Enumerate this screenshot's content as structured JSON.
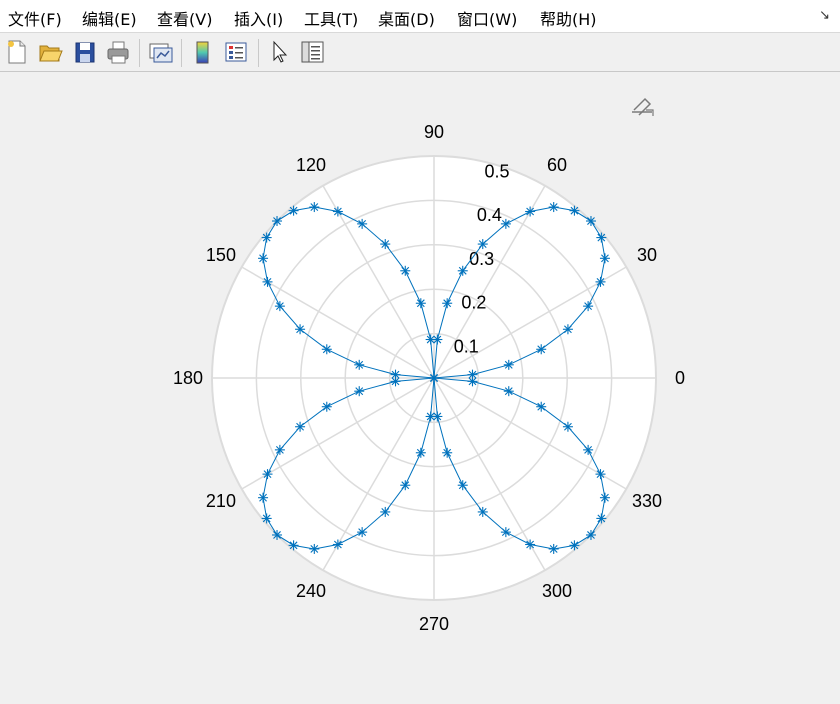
{
  "menubar": {
    "items": [
      {
        "label": "文件(F)",
        "name": "menu-file"
      },
      {
        "label": "编辑(E)",
        "name": "menu-edit"
      },
      {
        "label": "查看(V)",
        "name": "menu-view"
      },
      {
        "label": "插入(I)",
        "name": "menu-insert"
      },
      {
        "label": "工具(T)",
        "name": "menu-tools"
      },
      {
        "label": "桌面(D)",
        "name": "menu-desktop"
      },
      {
        "label": "窗口(W)",
        "name": "menu-window"
      },
      {
        "label": "帮助(H)",
        "name": "menu-help"
      }
    ],
    "dock_arrow": "↘"
  },
  "toolbar": {
    "buttons": [
      {
        "name": "new-figure-button",
        "icon": "new-file-icon"
      },
      {
        "name": "open-file-button",
        "icon": "folder-open-icon"
      },
      {
        "name": "save-button",
        "icon": "save-icon"
      },
      {
        "name": "print-button",
        "icon": "printer-icon"
      },
      {
        "name": "link-plot-button",
        "icon": "link-plot-icon"
      },
      {
        "name": "insert-colorbar-button",
        "icon": "colorbar-icon"
      },
      {
        "name": "insert-legend-button",
        "icon": "legend-icon"
      },
      {
        "name": "edit-plot-button",
        "icon": "cursor-arrow-icon"
      },
      {
        "name": "property-inspector-button",
        "icon": "property-inspector-icon"
      }
    ]
  },
  "axes_toolbar": {
    "icon": "edit-axes-icon"
  },
  "chart_data": {
    "type": "polar-line",
    "function": "r = 0.5 * |sin(2θ)|",
    "marker": "*",
    "line_color": "#0072bd",
    "theta_ticks": [
      "0",
      "30",
      "60",
      "90",
      "120",
      "150",
      "180",
      "210",
      "240",
      "270",
      "300",
      "330"
    ],
    "r_ticks": [
      "0.1",
      "0.2",
      "0.3",
      "0.4",
      "0.5"
    ],
    "rlim": [
      0,
      0.5
    ],
    "theta_deg": [
      0,
      5,
      10,
      15,
      20,
      25,
      30,
      35,
      40,
      45,
      50,
      55,
      60,
      65,
      70,
      75,
      80,
      85,
      90,
      95,
      100,
      105,
      110,
      115,
      120,
      125,
      130,
      135,
      140,
      145,
      150,
      155,
      160,
      165,
      170,
      175,
      180,
      185,
      190,
      195,
      200,
      205,
      210,
      215,
      220,
      225,
      230,
      235,
      240,
      245,
      250,
      255,
      260,
      265,
      270,
      275,
      280,
      285,
      290,
      295,
      300,
      305,
      310,
      315,
      320,
      325,
      330,
      335,
      340,
      345,
      350,
      355,
      360
    ],
    "r": [
      0,
      0.087,
      0.171,
      0.25,
      0.321,
      0.383,
      0.433,
      0.47,
      0.492,
      0.5,
      0.492,
      0.47,
      0.433,
      0.383,
      0.321,
      0.25,
      0.171,
      0.087,
      0,
      0.087,
      0.171,
      0.25,
      0.321,
      0.383,
      0.433,
      0.47,
      0.492,
      0.5,
      0.492,
      0.47,
      0.433,
      0.383,
      0.321,
      0.25,
      0.171,
      0.087,
      0,
      0.087,
      0.171,
      0.25,
      0.321,
      0.383,
      0.433,
      0.47,
      0.492,
      0.5,
      0.492,
      0.47,
      0.433,
      0.383,
      0.321,
      0.25,
      0.171,
      0.087,
      0,
      0.087,
      0.171,
      0.25,
      0.321,
      0.383,
      0.433,
      0.47,
      0.492,
      0.5,
      0.492,
      0.47,
      0.433,
      0.383,
      0.321,
      0.25,
      0.171,
      0.087,
      0
    ],
    "grid": true
  }
}
